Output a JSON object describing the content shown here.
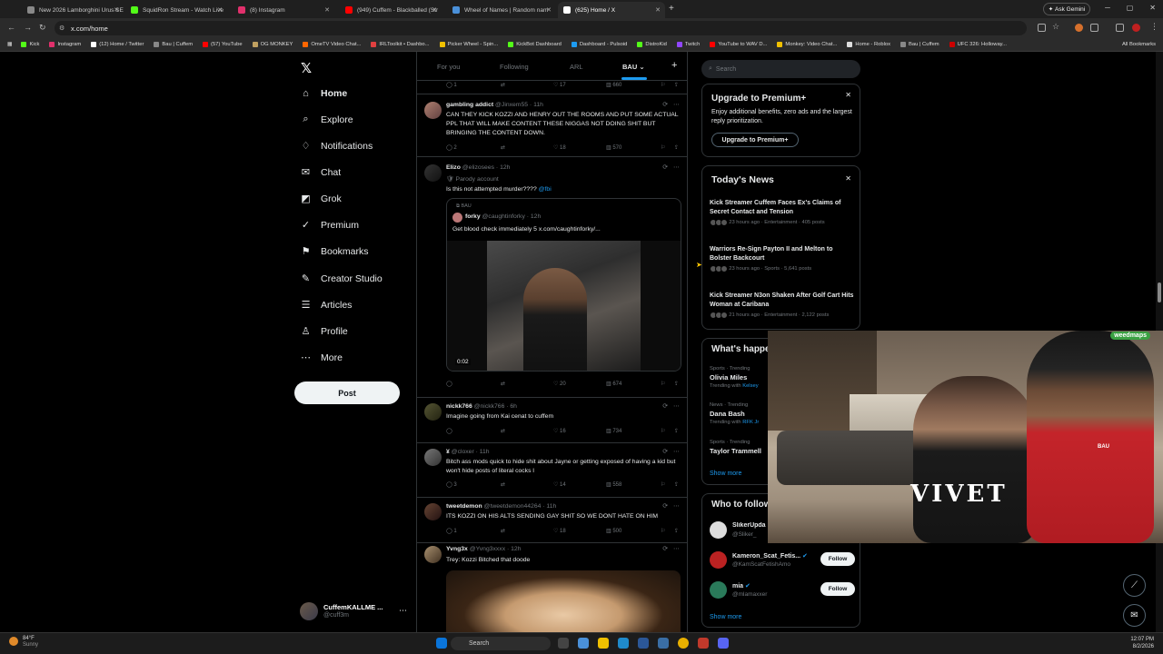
{
  "browser": {
    "tabs": [
      {
        "title": "New 2026 Lamborghini Urus SE",
        "color": "#888888"
      },
      {
        "title": "SquidRon Stream - Watch Live",
        "color": "#53fc18"
      },
      {
        "title": "(8) Instagram",
        "color": "#e1306c"
      },
      {
        "title": "(949) Cuffem - Blackballed (Str",
        "color": "#ff0000"
      },
      {
        "title": "Wheel of Names | Random nam",
        "color": "#4a90d9"
      },
      {
        "title": "(625) Home / X",
        "color": "#ffffff"
      }
    ],
    "new_tab": "+",
    "gemini": "Ask Gemini",
    "url": "x.com/home",
    "bookmarks": [
      {
        "label": "Kick",
        "color": "#53fc18"
      },
      {
        "label": "Instagram",
        "color": "#e1306c"
      },
      {
        "label": "(12) Home / Twitter",
        "color": "#ffffff"
      },
      {
        "label": "Bau | Cuffem",
        "color": "#888888"
      },
      {
        "label": "(57) YouTube",
        "color": "#ff0000"
      },
      {
        "label": "OG MONKEY",
        "color": "#c0a060"
      },
      {
        "label": "OmeTV Video Chat...",
        "color": "#ff6600"
      },
      {
        "label": "IRLToolkit • Dashbo...",
        "color": "#e04040"
      },
      {
        "label": "Picker Wheel - Spin...",
        "color": "#f0c000"
      },
      {
        "label": "KickBot Dashboard",
        "color": "#53fc18"
      },
      {
        "label": "Dashboard - Pulsoid",
        "color": "#1d9bf0"
      },
      {
        "label": "DistroKid",
        "color": "#53fc18"
      },
      {
        "label": "Twitch",
        "color": "#9146ff"
      },
      {
        "label": "YouTube to WAV D...",
        "color": "#ff0000"
      },
      {
        "label": "Monkey: Video Chat...",
        "color": "#f0c000"
      },
      {
        "label": "Home - Roblox",
        "color": "#dddddd"
      },
      {
        "label": "Bau | Cuffem",
        "color": "#888888"
      },
      {
        "label": "UFC 326: Holloway...",
        "color": "#cc0000"
      }
    ],
    "all_bookmarks": "All Bookmarks"
  },
  "sidebar": {
    "logo": "𝕏",
    "items": [
      {
        "label": "Home",
        "icon": "home-icon",
        "glyph": "⌂"
      },
      {
        "label": "Explore",
        "icon": "search-icon",
        "glyph": "⌕"
      },
      {
        "label": "Notifications",
        "icon": "bell-icon",
        "glyph": "♢"
      },
      {
        "label": "Chat",
        "icon": "mail-icon",
        "glyph": "✉"
      },
      {
        "label": "Grok",
        "icon": "grok-icon",
        "glyph": "◩"
      },
      {
        "label": "Premium",
        "icon": "premium-icon",
        "glyph": "✓"
      },
      {
        "label": "Bookmarks",
        "icon": "bookmark-icon",
        "glyph": "⚑"
      },
      {
        "label": "Creator Studio",
        "icon": "creator-icon",
        "glyph": "✎"
      },
      {
        "label": "Articles",
        "icon": "article-icon",
        "glyph": "☰"
      },
      {
        "label": "Profile",
        "icon": "person-icon",
        "glyph": "♙"
      },
      {
        "label": "More",
        "icon": "more-icon",
        "glyph": "⋯"
      }
    ],
    "post": "Post",
    "account_name": "CuffemKALLME ...",
    "account_handle": "@cuff3m"
  },
  "feed": {
    "tabs": [
      "For you",
      "Following",
      "ARL",
      "BAU"
    ],
    "active_tab": "BAU ⌄",
    "plus": "+",
    "top_actions": {
      "reply": "1",
      "likes": "17",
      "views": "660"
    },
    "tweets": [
      {
        "name": "gambling addict",
        "handle": "@Jinxem55",
        "time": "11h",
        "text": "CAN THEY KICK KOZZI AND HENRY OUT THE ROOMS AND PUT SOME ACTUAL PPL THAT WILL MAKE CONTENT THESE NIGGAS NOT DOING SHIT BUT BRINGING THE CONTENT DOWN.",
        "reply": "2",
        "repost": "",
        "like": "18",
        "views": "570"
      },
      {
        "name": "Elizo",
        "handle": "@elizosees",
        "time": "12h",
        "sub": "Parody account",
        "text": "Is this not attempted murder????",
        "mention": "@fbi",
        "quote_label": "BAU",
        "quote_name": "forky",
        "quote_handle": "@caughtinforky",
        "quote_time": "12h",
        "quote_text": "Get blood check immediately 5  x.com/caughtinforky/...",
        "video_time": "0:02",
        "reply": "",
        "repost": "",
        "like": "20",
        "views": "674"
      },
      {
        "name": "nickk766",
        "handle": "@nickk766",
        "time": "6h",
        "text": "Imagine going from Kai cenat to cuffem",
        "reply": "",
        "repost": "",
        "like": "16",
        "views": "734"
      },
      {
        "name": "¥",
        "handle": "@cloxer",
        "time": "11h",
        "text": "Bitch ass mods quick to hide shit about Jayne or getting exposed of having a kid but won't hide posts of literal cocks l",
        "reply": "3",
        "repost": "",
        "like": "14",
        "views": "558"
      },
      {
        "name": "tweetdemon",
        "handle": "@tweetdemon44264",
        "time": "11h",
        "text": "ITS KOZZI ON HIS ALTS SENDING GAY SHIT SO WE DONT HATE ON HIM",
        "reply": "1",
        "repost": "",
        "like": "18",
        "views": "500"
      },
      {
        "name": "Yvng3x",
        "handle": "@Yvng3xxxx",
        "time": "12h",
        "text": "Trey: Kozzi Bitched that doode"
      }
    ]
  },
  "right": {
    "search_placeholder": "Search",
    "premium_title": "Upgrade to Premium+",
    "premium_text": "Enjoy additional benefits, zero ads and the largest reply prioritization.",
    "premium_button": "Upgrade to Premium+",
    "news_title": "Today's News",
    "news": [
      {
        "title": "Kick Streamer Cuffem Faces Ex's Claims of Secret Contact and Tension",
        "meta": "23 hours ago · Entertainment · 405 posts"
      },
      {
        "title": "Warriors Re-Sign Payton II and Melton to Bolster Backcourt",
        "meta": "23 hours ago · Sports · 5,641 posts"
      },
      {
        "title": "Kick Streamer N3on Shaken After Golf Cart Hits Woman at Caribana",
        "meta": "21 hours ago · Entertainment · 2,122 posts"
      }
    ],
    "happening_title": "What's happe",
    "trends": [
      {
        "cat": "Sports · Trending",
        "name": "Olivia Miles",
        "with": "Trending with",
        "link": "Kelsey"
      },
      {
        "cat": "News · Trending",
        "name": "Dana Bash",
        "with": "Trending with",
        "link": "RFK Jr"
      },
      {
        "cat": "Sports · Trending",
        "name": "Taylor Trammell",
        "with": "",
        "link": ""
      }
    ],
    "show_more": "Show more",
    "follow_title": "Who to follow",
    "follows": [
      {
        "name": "SlikerUpda",
        "handle": "@Sliker_",
        "button": ""
      },
      {
        "name": "Kameron_Scat_Fetis...",
        "handle": "@KamScatFetishAmo",
        "button": "Follow"
      },
      {
        "name": "mia",
        "handle": "@mlamaxxer",
        "button": "Follow"
      }
    ],
    "show_more2": "Show more"
  },
  "webcam": {
    "logo": "weedmaps",
    "shirt": "VIVET",
    "shirt2": "BAU"
  },
  "taskbar": {
    "temp": "84°F",
    "cond": "Sunny",
    "search": "Search",
    "time": "12:07 PM",
    "date": "8/2/2026"
  }
}
